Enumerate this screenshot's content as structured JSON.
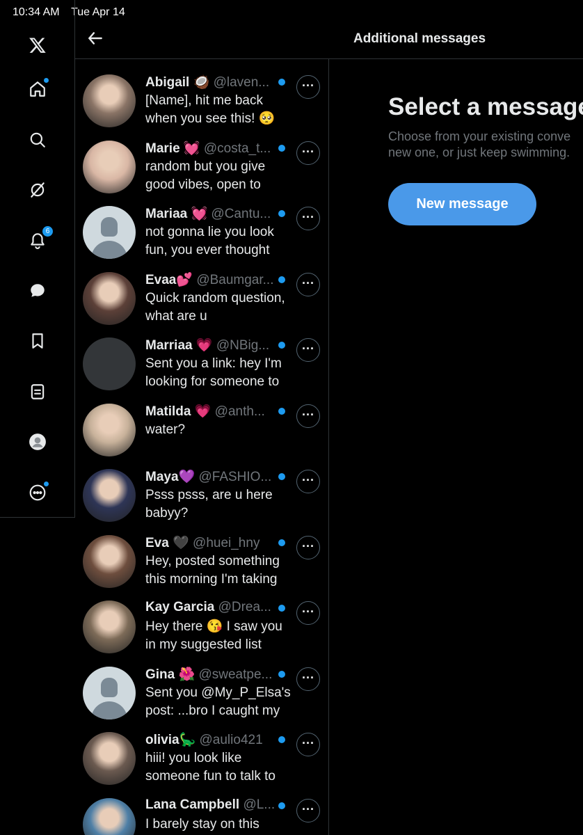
{
  "status_bar": {
    "time": "10:34 AM",
    "date": "Tue Apr 14"
  },
  "nav": {
    "items": [
      {
        "icon": "x-logo-icon"
      },
      {
        "icon": "home-icon",
        "dot": true
      },
      {
        "icon": "search-icon"
      },
      {
        "icon": "grok-icon"
      },
      {
        "icon": "notifications-icon",
        "badge": "6"
      },
      {
        "icon": "messages-icon"
      },
      {
        "icon": "bookmarks-icon"
      },
      {
        "icon": "lists-icon"
      },
      {
        "icon": "profile-avatar-icon"
      },
      {
        "icon": "more-icon",
        "dot": true
      }
    ]
  },
  "header": {
    "title": "Additional messages"
  },
  "conversations": [
    {
      "name": "Abigail 🥥",
      "handle": "@laven...",
      "preview": "[Name], hit me back when you see this! 🥺",
      "avatar": "#8a7466"
    },
    {
      "name": "Marie 💓",
      "handle": "@costa_t...",
      "preview": "random but you give good vibes, open to",
      "avatar": "#d9b7a5"
    },
    {
      "name": "Mariaa 💓",
      "handle": "@Cantu...",
      "preview": "not gonna lie you look fun, you ever thought",
      "avatar": "default"
    },
    {
      "name": "Evaa💕",
      "handle": "@Baumgar...",
      "preview": "Quick random question, what are u",
      "avatar": "#5c4038"
    },
    {
      "name": "Marriaa 💗",
      "handle": "@NBig...",
      "preview": "Sent you a link: hey I'm looking for someone to",
      "avatar": "dark"
    },
    {
      "name": "Matilda 💗",
      "handle": "@anth...",
      "preview": "water?",
      "avatar": "#c7b19a"
    },
    {
      "name": "Maya💜",
      "handle": "@FASHIO...",
      "preview": "Psss psss, are u here babyy?",
      "avatar": "#2e3556"
    },
    {
      "name": "Eva 🖤",
      "handle": "@huei_hny",
      "preview": "Hey, posted something this morning I'm taking",
      "avatar": "#6e4e3e"
    },
    {
      "name": "Kay Garcia",
      "handle": "@Drea...",
      "preview": "Hey there 😘 I saw you in my suggested list",
      "avatar": "#7d6b58"
    },
    {
      "name": "Gina 🌺",
      "handle": "@sweatpe...",
      "preview": "Sent you @My_P_Elsa's post: ...bro I caught my",
      "avatar": "default"
    },
    {
      "name": "olivia🦕",
      "handle": "@aulio421",
      "preview": "hiii! you look like someone fun to talk to",
      "avatar": "#6b5a50"
    },
    {
      "name": "Lana Campbell",
      "handle": "@L...",
      "preview": "I barely stay on this",
      "avatar": "#4e7fa6"
    }
  ],
  "more_label": "···",
  "empty_state": {
    "title": "Select a message",
    "subtitle_line1": "Choose from your existing conve",
    "subtitle_line2": "new one, or just keep swimming.",
    "button": "New message"
  },
  "colors": {
    "accent": "#1d9bf0",
    "button": "#4a99e9",
    "border": "#2f3336",
    "muted": "#71767b"
  }
}
